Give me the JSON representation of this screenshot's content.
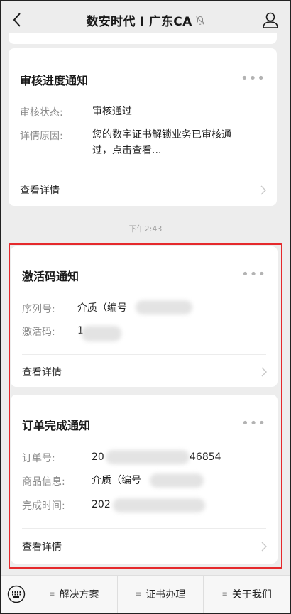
{
  "header": {
    "title": "数安时代 I 广东CA",
    "back_icon": "back-chevron-icon",
    "profile_icon": "profile-icon",
    "mute_icon": "bell-muted-icon"
  },
  "cards": {
    "review": {
      "title": "审核进度通知",
      "more": "•••",
      "status_label": "审核状态:",
      "status_value": "审核通过",
      "reason_label": "详情原因:",
      "reason_line1": "您的数字证书解锁业务已审核通",
      "reason_line2": "过，点击查看...",
      "detail": "查看详情"
    },
    "activation": {
      "title": "激活码通知",
      "more": "•••",
      "serial_label": "序列号:",
      "serial_value": "介质（编号",
      "code_label": "激活码:",
      "code_value": "1",
      "detail": "查看详情"
    },
    "order": {
      "title": "订单完成通知",
      "more": "•••",
      "order_label": "订单号:",
      "order_prefix": "20",
      "order_suffix": "46854",
      "product_label": "商品信息:",
      "product_value": "介质（编号",
      "time_label": "完成时间:",
      "time_value": "202",
      "detail": "查看详情"
    }
  },
  "timestamp": "下午2:43",
  "menu": {
    "keyboard_icon": "keyboard-icon",
    "items": [
      "解决方案",
      "证书办理",
      "关于我们"
    ],
    "menu_glyph": "≡"
  },
  "colors": {
    "highlight": "#e5292c",
    "background": "#ededed"
  }
}
